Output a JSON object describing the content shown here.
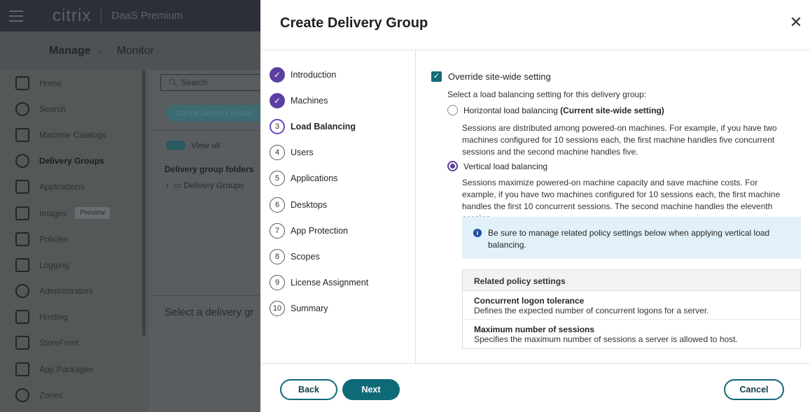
{
  "background_app": {
    "brand": "citrix",
    "product": "DaaS Premium",
    "manage_label": "Manage",
    "monitor_label": "Monitor",
    "nav": [
      {
        "label": "Home",
        "icon": "home-icon"
      },
      {
        "label": "Search",
        "icon": "search-icon"
      },
      {
        "label": "Machine Catalogs",
        "icon": "machine-catalogs-icon"
      },
      {
        "label": "Delivery Groups",
        "icon": "delivery-groups-icon"
      },
      {
        "label": "Applications",
        "icon": "applications-icon"
      },
      {
        "label": "Images",
        "icon": "images-icon",
        "badge": "Preview"
      },
      {
        "label": "Policies",
        "icon": "policies-icon"
      },
      {
        "label": "Logging",
        "icon": "logging-icon"
      },
      {
        "label": "Administrators",
        "icon": "administrators-icon"
      },
      {
        "label": "Hosting",
        "icon": "hosting-icon"
      },
      {
        "label": "StoreFront",
        "icon": "storefront-icon"
      },
      {
        "label": "App Packages",
        "icon": "app-packages-icon"
      },
      {
        "label": "Zones",
        "icon": "zones-icon"
      }
    ],
    "search_placeholder": "Search",
    "create_button": "Create Delivery Group",
    "view_all": "View all",
    "folders_heading": "Delivery group folders",
    "folder_item": "Delivery Groups",
    "select_prompt": "Select a delivery gr"
  },
  "modal": {
    "title": "Create Delivery Group",
    "steps": [
      {
        "num": "1",
        "label": "Introduction",
        "state": "done"
      },
      {
        "num": "2",
        "label": "Machines",
        "state": "done"
      },
      {
        "num": "3",
        "label": "Load Balancing",
        "state": "current"
      },
      {
        "num": "4",
        "label": "Users",
        "state": "todo"
      },
      {
        "num": "5",
        "label": "Applications",
        "state": "todo"
      },
      {
        "num": "6",
        "label": "Desktops",
        "state": "todo"
      },
      {
        "num": "7",
        "label": "App Protection",
        "state": "todo"
      },
      {
        "num": "8",
        "label": "Scopes",
        "state": "todo"
      },
      {
        "num": "9",
        "label": "License Assignment",
        "state": "todo"
      },
      {
        "num": "10",
        "label": "Summary",
        "state": "todo"
      }
    ],
    "override_label": "Override site-wide setting",
    "select_label": "Select a load balancing setting for this delivery group:",
    "horizontal_label": "Horizontal load balancing",
    "horizontal_suffix": "(Current site-wide setting)",
    "horizontal_desc": "Sessions are distributed among powered-on machines. For example, if you have two machines configured for 10 sessions each, the first machine handles five concurrent sessions and the second machine handles five.",
    "vertical_label": "Vertical load balancing",
    "vertical_desc": "Sessions maximize powered-on machine capacity and save machine costs. For example, if you have two machines configured for 10 sessions each, the first machine handles the first 10 concurrent sessions. The second machine handles the eleventh session.",
    "info_text": "Be sure to manage related policy settings below when applying vertical load balancing.",
    "policy_heading": "Related policy settings",
    "policies": [
      {
        "name": "Concurrent logon tolerance",
        "desc": "Defines the expected number of concurrent logons for a server."
      },
      {
        "name": "Maximum number of sessions",
        "desc": "Specifies the maximum number of sessions a server is allowed to host."
      }
    ],
    "back_label": "Back",
    "next_label": "Next",
    "cancel_label": "Cancel"
  },
  "colors": {
    "accent_teal": "#0f6a78",
    "accent_purple": "#5b3fa0",
    "info_bg": "#e2f1f9"
  }
}
